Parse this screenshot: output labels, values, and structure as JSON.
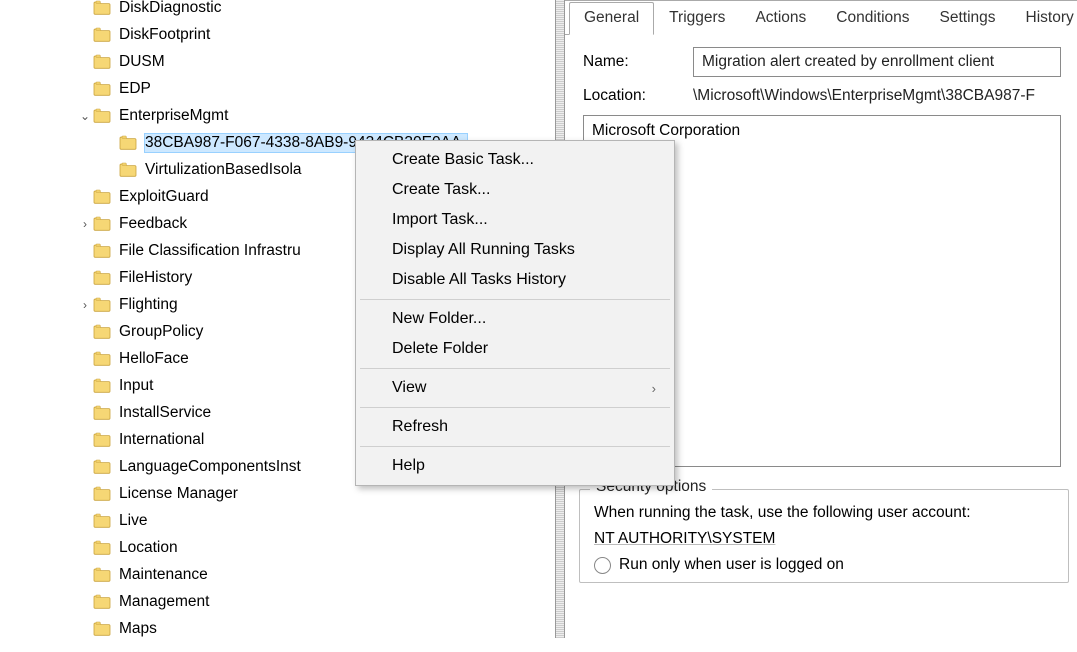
{
  "tree": {
    "items": [
      {
        "expand": "",
        "indent": 105,
        "label": "DiskDiagnostic"
      },
      {
        "expand": "",
        "indent": 105,
        "label": "DiskFootprint"
      },
      {
        "expand": "",
        "indent": 105,
        "label": "DUSM"
      },
      {
        "expand": "",
        "indent": 105,
        "label": "EDP"
      },
      {
        "expand": "v",
        "indent": 105,
        "label": "EnterpriseMgmt"
      },
      {
        "expand": "",
        "indent": 131,
        "label": "38CBA987-F067-4338-8AB9-9434CB30E0AA",
        "sel": true
      },
      {
        "expand": "",
        "indent": 131,
        "label": "VirtulizationBasedIsola"
      },
      {
        "expand": "",
        "indent": 105,
        "label": "ExploitGuard"
      },
      {
        "expand": ">",
        "indent": 105,
        "label": "Feedback"
      },
      {
        "expand": "",
        "indent": 105,
        "label": "File Classification Infrastru"
      },
      {
        "expand": "",
        "indent": 105,
        "label": "FileHistory"
      },
      {
        "expand": ">",
        "indent": 105,
        "label": "Flighting"
      },
      {
        "expand": "",
        "indent": 105,
        "label": "GroupPolicy"
      },
      {
        "expand": "",
        "indent": 105,
        "label": "HelloFace"
      },
      {
        "expand": "",
        "indent": 105,
        "label": "Input"
      },
      {
        "expand": "",
        "indent": 105,
        "label": "InstallService"
      },
      {
        "expand": "",
        "indent": 105,
        "label": "International"
      },
      {
        "expand": "",
        "indent": 105,
        "label": "LanguageComponentsInst"
      },
      {
        "expand": "",
        "indent": 105,
        "label": "License Manager"
      },
      {
        "expand": "",
        "indent": 105,
        "label": "Live"
      },
      {
        "expand": "",
        "indent": 105,
        "label": "Location"
      },
      {
        "expand": "",
        "indent": 105,
        "label": "Maintenance"
      },
      {
        "expand": "",
        "indent": 105,
        "label": "Management"
      },
      {
        "expand": "",
        "indent": 105,
        "label": "Maps"
      }
    ]
  },
  "tabs": [
    "General",
    "Triggers",
    "Actions",
    "Conditions",
    "Settings",
    "History"
  ],
  "details": {
    "name_label": "Name:",
    "name_value": "Migration alert created by enrollment client",
    "location_label": "Location:",
    "location_value": "\\Microsoft\\Windows\\EnterpriseMgmt\\38CBA987-F",
    "author_value": "Microsoft Corporation"
  },
  "security": {
    "legend": "Security options",
    "line1": "When running the task, use the following user account:",
    "account": "NT AUTHORITY\\SYSTEM",
    "radio1": "Run only when user is logged on"
  },
  "ctx": {
    "items": [
      {
        "label": "Create Basic Task..."
      },
      {
        "label": "Create Task..."
      },
      {
        "label": "Import Task..."
      },
      {
        "label": "Display All Running Tasks"
      },
      {
        "label": "Disable All Tasks History"
      },
      {
        "sep": true
      },
      {
        "label": "New Folder..."
      },
      {
        "label": "Delete Folder"
      },
      {
        "sep": true
      },
      {
        "label": "View",
        "sub": true
      },
      {
        "sep": true
      },
      {
        "label": "Refresh"
      },
      {
        "sep": true
      },
      {
        "label": "Help"
      }
    ]
  }
}
